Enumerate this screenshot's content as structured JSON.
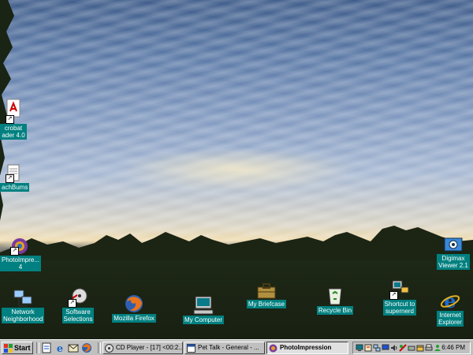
{
  "desktop": {
    "icons": {
      "acrobat": "crobat\nader 4.0",
      "beachbums": "achBums",
      "photoimpression": "PhotoImpre...\n4",
      "network": "Network\nNeighborhood",
      "software": "Software\nSelections",
      "firefox": "Mozilla Firefox",
      "mycomputer": "My Computer",
      "briefcase": "My Briefcase",
      "recycle": "Recycle Bin",
      "supernerd": "Shortcut to\nsupernerd",
      "ie": "Internet\nExplorer",
      "digimax": "Digimax\nViewer 2.1"
    }
  },
  "taskbar": {
    "start_label": "Start",
    "tasks": [
      {
        "label": "CD Player - [17] <00:2..."
      },
      {
        "label": "Pet Talk - General - ..."
      },
      {
        "label": "PhotoImpression"
      }
    ],
    "clock": "6:46 PM"
  }
}
